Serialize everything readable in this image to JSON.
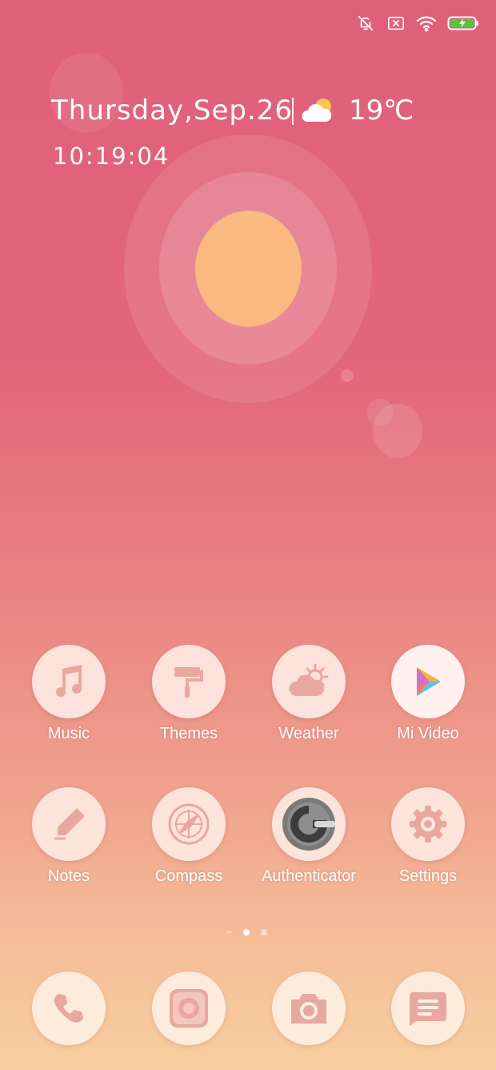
{
  "status_bar": {
    "icons": [
      "mute-vibrate-icon",
      "no-sim-icon",
      "wifi-icon",
      "battery-charging-icon"
    ],
    "battery_color": "#5ac33c"
  },
  "clock_widget": {
    "date": "Thursday,Sep.26",
    "weather_icon": "partly-cloudy-icon",
    "temperature": "19℃",
    "time": "10:19:04"
  },
  "apps": [
    {
      "label": "Music",
      "icon": "music-note-icon"
    },
    {
      "label": "Themes",
      "icon": "paint-roller-icon"
    },
    {
      "label": "Weather",
      "icon": "cloud-sun-icon"
    },
    {
      "label": "Mi Video",
      "icon": "play-icon"
    },
    {
      "label": "Notes",
      "icon": "pencil-icon"
    },
    {
      "label": "Compass",
      "icon": "compass-icon"
    },
    {
      "label": "Authenticator",
      "icon": "google-authenticator-icon"
    },
    {
      "label": "Settings",
      "icon": "gear-icon"
    }
  ],
  "page_indicator": {
    "pages": 3,
    "current": 2
  },
  "dock": [
    {
      "icon": "phone-icon"
    },
    {
      "icon": "browser-icon"
    },
    {
      "icon": "camera-icon"
    },
    {
      "icon": "messages-icon"
    }
  ],
  "colors": {
    "icon_tint": "#e8a8a0",
    "sun": "#f9b97f",
    "background_top": "#e0607a",
    "background_bottom": "#f7cf9f"
  }
}
